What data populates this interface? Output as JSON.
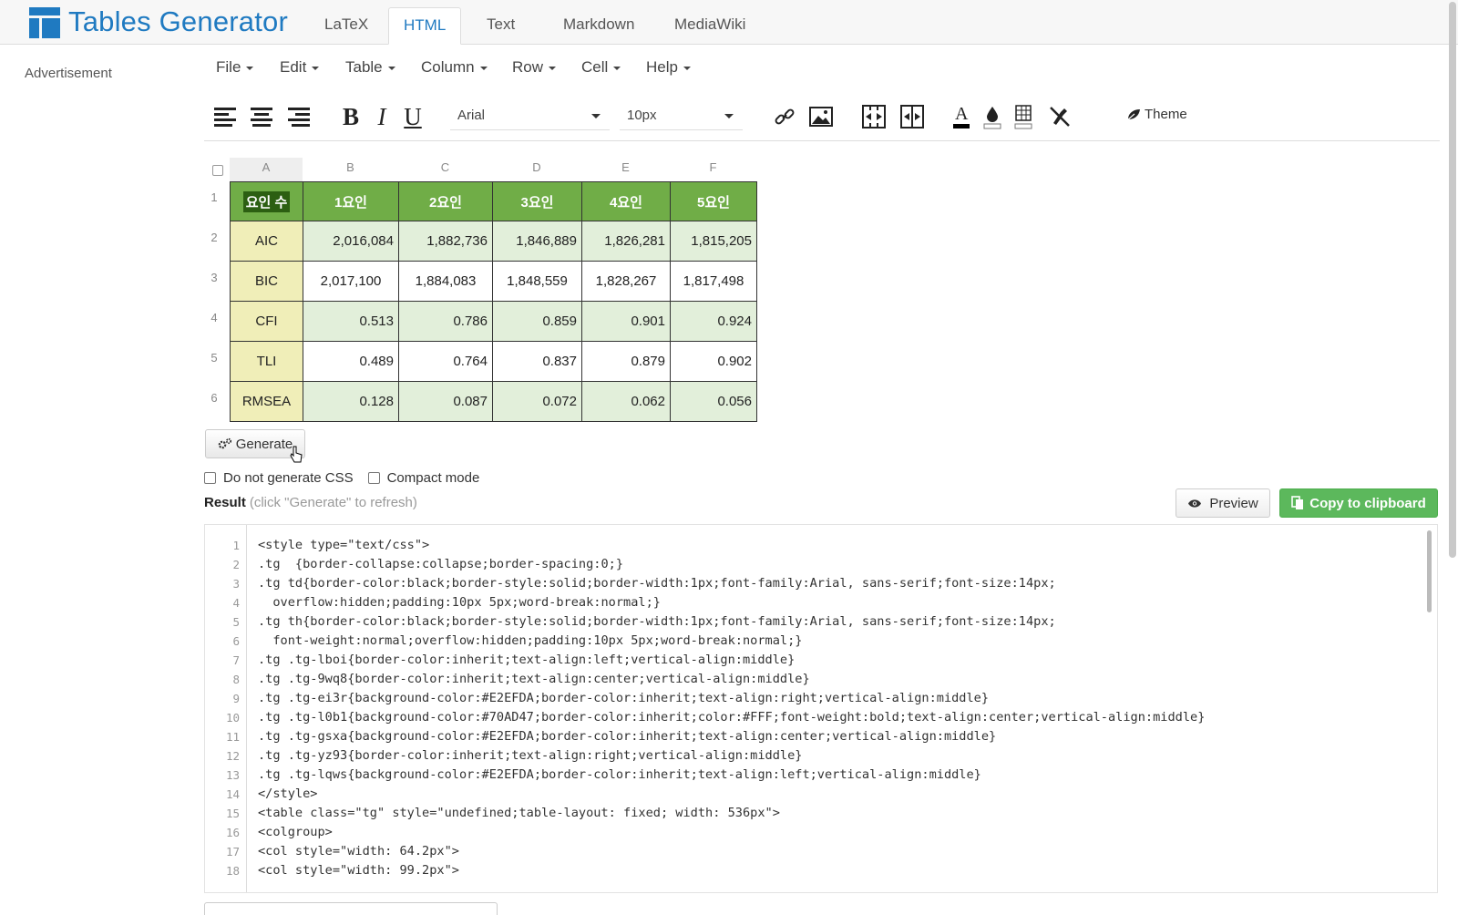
{
  "app": {
    "brand": "Tables Generator",
    "tabs": [
      {
        "label": "LaTeX",
        "active": false
      },
      {
        "label": "HTML",
        "active": true
      },
      {
        "label": "Text",
        "active": false
      },
      {
        "label": "Markdown",
        "active": false
      },
      {
        "label": "MediaWiki",
        "active": false
      }
    ],
    "advertisement": "Advertisement"
  },
  "menu": [
    "File",
    "Edit",
    "Table",
    "Column",
    "Row",
    "Cell",
    "Help"
  ],
  "toolbar": {
    "font": "Arial",
    "size": "10px",
    "theme": "Theme",
    "icons": [
      "align-left-icon",
      "align-center-icon",
      "align-right-icon",
      "bold-icon",
      "italic-icon",
      "underline-icon",
      "link-icon",
      "image-icon",
      "merge-cells-icon",
      "split-cells-icon",
      "text-color-icon",
      "fill-color-icon",
      "borders-icon",
      "clear-format-icon",
      "theme-icon"
    ],
    "bold": "B",
    "italic": "I",
    "underline": "U"
  },
  "grid": {
    "columns": [
      "A",
      "B",
      "C",
      "D",
      "E",
      "F"
    ],
    "rows": [
      "1",
      "2",
      "3",
      "4",
      "5",
      "6"
    ],
    "header": [
      "요인 수",
      "1요인",
      "2요인",
      "3요인",
      "4요인",
      "5요인"
    ],
    "body": [
      [
        "AIC",
        "2,016,084",
        "1,882,736",
        "1,846,889",
        "1,826,281",
        "1,815,205"
      ],
      [
        "BIC",
        "2,017,100",
        "1,884,083",
        "1,848,559",
        "1,828,267",
        "1,817,498"
      ],
      [
        "CFI",
        "0.513",
        "0.786",
        "0.859",
        "0.901",
        "0.924"
      ],
      [
        "TLI",
        "0.489",
        "0.764",
        "0.837",
        "0.879",
        "0.902"
      ],
      [
        "RMSEA",
        "0.128",
        "0.087",
        "0.072",
        "0.062",
        "0.056"
      ]
    ],
    "colors": {
      "header": "#70AD47",
      "alt_row": "#E2EFDA",
      "label": "#F0EEB8"
    }
  },
  "actions": {
    "generate": "Generate",
    "no_css": "Do not generate CSS",
    "compact": "Compact mode",
    "result": "Result",
    "result_hint": "(click \"Generate\" to refresh)",
    "preview": "Preview",
    "copy": "Copy to clipboard"
  },
  "code_lines": [
    {
      "n": "1",
      "text": "<style type=\"text/css\">"
    },
    {
      "n": "2",
      "text": ".tg  {border-collapse:collapse;border-spacing:0;}"
    },
    {
      "n": "3",
      "text": ".tg td{border-color:black;border-style:solid;border-width:1px;font-family:Arial, sans-serif;font-size:14px;"
    },
    {
      "n": "4",
      "text": "  overflow:hidden;padding:10px 5px;word-break:normal;}"
    },
    {
      "n": "5",
      "text": ".tg th{border-color:black;border-style:solid;border-width:1px;font-family:Arial, sans-serif;font-size:14px;"
    },
    {
      "n": "6",
      "text": "  font-weight:normal;overflow:hidden;padding:10px 5px;word-break:normal;}"
    },
    {
      "n": "7",
      "text": ".tg .tg-lboi{border-color:inherit;text-align:left;vertical-align:middle}"
    },
    {
      "n": "8",
      "text": ".tg .tg-9wq8{border-color:inherit;text-align:center;vertical-align:middle}"
    },
    {
      "n": "9",
      "text": ".tg .tg-ei3r{background-color:#E2EFDA;border-color:inherit;text-align:right;vertical-align:middle}"
    },
    {
      "n": "10",
      "text": ".tg .tg-l0b1{background-color:#70AD47;border-color:inherit;color:#FFF;font-weight:bold;text-align:center;vertical-align:middle}"
    },
    {
      "n": "11",
      "text": ".tg .tg-gsxa{background-color:#E2EFDA;border-color:inherit;text-align:center;vertical-align:middle}"
    },
    {
      "n": "12",
      "text": ".tg .tg-yz93{border-color:inherit;text-align:right;vertical-align:middle}"
    },
    {
      "n": "13",
      "text": ".tg .tg-lqws{background-color:#E2EFDA;border-color:inherit;text-align:left;vertical-align:middle}"
    },
    {
      "n": "14",
      "text": "</style>"
    },
    {
      "n": "15",
      "text": "<table class=\"tg\" style=\"undefined;table-layout: fixed; width: 536px\">"
    },
    {
      "n": "16",
      "text": "<colgroup>"
    },
    {
      "n": "17",
      "text": "<col style=\"width: 64.2px\">"
    },
    {
      "n": "18",
      "text": "<col style=\"width: 99.2px\">"
    }
  ]
}
